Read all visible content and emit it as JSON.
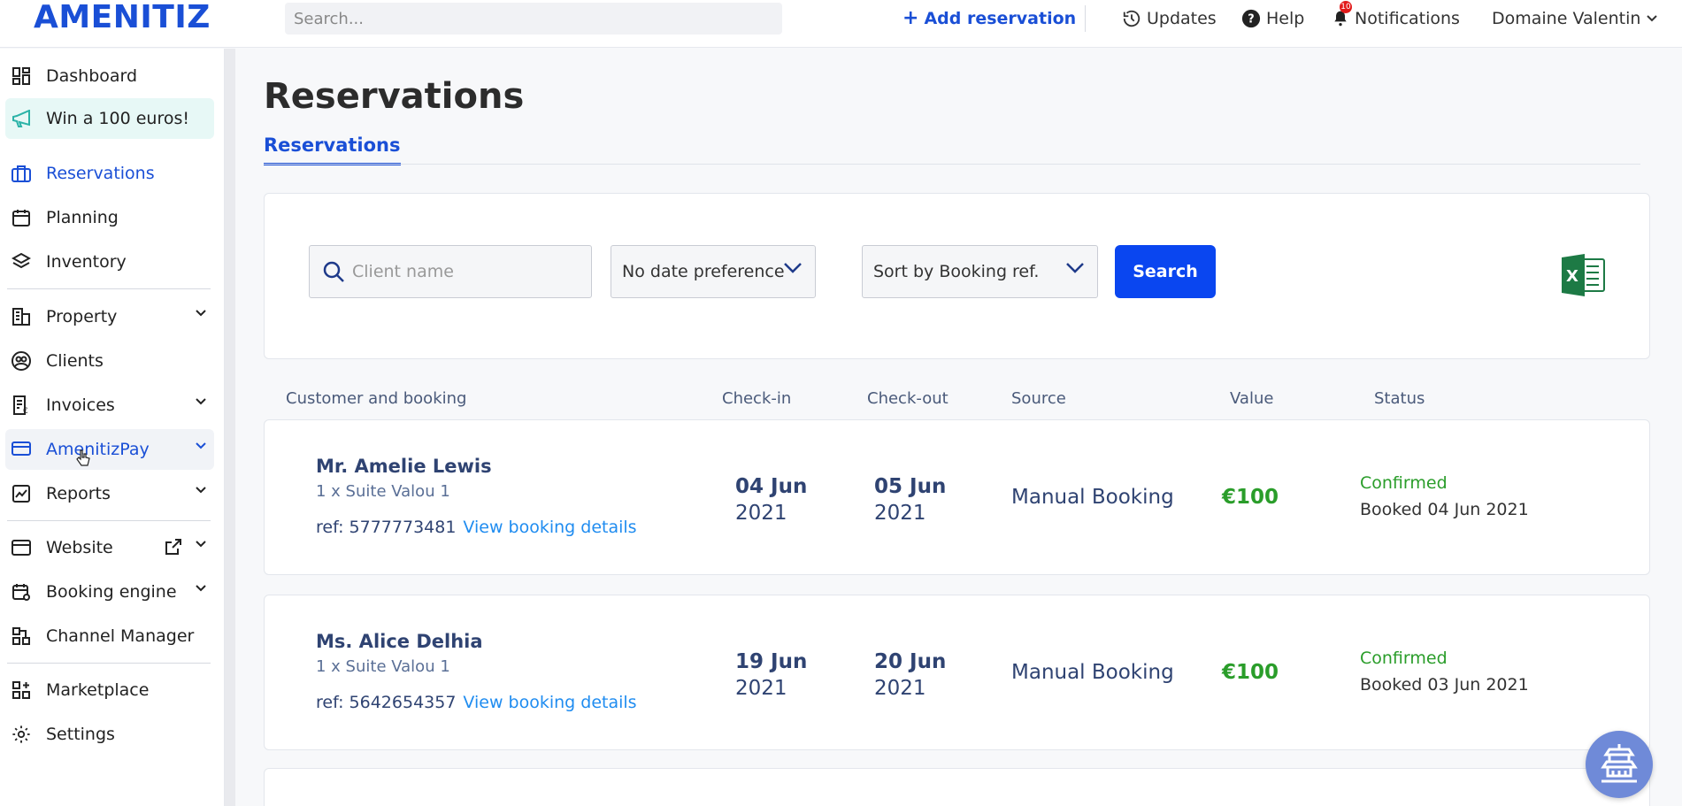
{
  "header": {
    "logo": "AMENITIZ",
    "search_placeholder": "Search...",
    "add_reservation": "Add reservation",
    "updates": "Updates",
    "help": "Help",
    "notifications": "Notifications",
    "notifications_count": "10",
    "user": "Domaine Valentin"
  },
  "sidebar": {
    "items": [
      {
        "label": "Dashboard",
        "icon": "dashboard-icon"
      },
      {
        "label": "Win a 100 euros!",
        "icon": "megaphone-icon"
      },
      {
        "label": "Reservations",
        "icon": "suitcase-icon"
      },
      {
        "label": "Planning",
        "icon": "calendar-icon"
      },
      {
        "label": "Inventory",
        "icon": "layers-icon"
      },
      {
        "label": "Property",
        "icon": "building-icon"
      },
      {
        "label": "Clients",
        "icon": "users-icon"
      },
      {
        "label": "Invoices",
        "icon": "invoice-icon"
      },
      {
        "label": "AmenitizPay",
        "icon": "card-icon"
      },
      {
        "label": "Reports",
        "icon": "chart-icon"
      },
      {
        "label": "Website",
        "icon": "browser-icon"
      },
      {
        "label": "Booking engine",
        "icon": "booking-icon"
      },
      {
        "label": "Channel Manager",
        "icon": "channels-icon"
      },
      {
        "label": "Marketplace",
        "icon": "grid-plus-icon"
      },
      {
        "label": "Settings",
        "icon": "gear-icon"
      }
    ]
  },
  "main": {
    "title": "Reservations",
    "tab": "Reservations",
    "filters": {
      "client_placeholder": "Client name",
      "date_pref": "No date preference",
      "sort": "Sort by Booking ref.",
      "search_button": "Search"
    },
    "columns": [
      "Customer and booking",
      "Check-in",
      "Check-out",
      "Source",
      "Value",
      "Status"
    ],
    "reservations": [
      {
        "name": "Mr. Amelie Lewis",
        "room": "1 x Suite Valou 1",
        "ref": "ref: 5777773481",
        "link": "View booking details",
        "checkin_day": "04 Jun",
        "checkin_year": "2021",
        "checkout_day": "05 Jun",
        "checkout_year": "2021",
        "source": "Manual Booking",
        "value": "€100",
        "status": "Confirmed",
        "booked": "Booked 04 Jun 2021"
      },
      {
        "name": "Ms. Alice Delhia",
        "room": "1 x Suite Valou 1",
        "ref": "ref: 5642654357",
        "link": "View booking details",
        "checkin_day": "19 Jun",
        "checkin_year": "2021",
        "checkout_day": "20 Jun",
        "checkout_year": "2021",
        "source": "Manual Booking",
        "value": "€100",
        "status": "Confirmed",
        "booked": "Booked 03 Jun 2021"
      }
    ]
  },
  "colors": {
    "primary": "#1a4fd6",
    "button": "#0a46f0",
    "success": "#2a9d2a",
    "link": "#1f8cf0"
  }
}
